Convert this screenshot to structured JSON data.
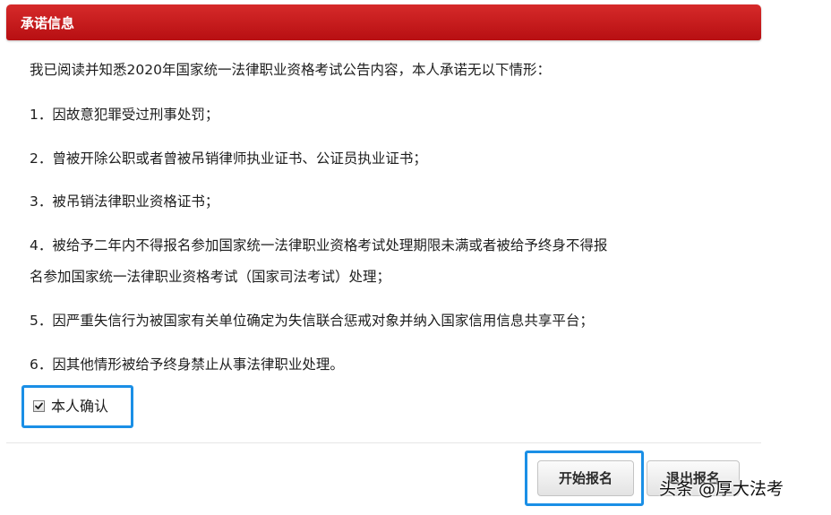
{
  "header": {
    "title": "承诺信息",
    "color": "#c4161c"
  },
  "content": {
    "intro": "我已阅读并知悉2020年国家统一法律职业资格考试公告内容，本人承诺无以下情形：",
    "items": [
      "1．因故意犯罪受过刑事处罚；",
      "2．曾被开除公职或者曾被吊销律师执业证书、公证员执业证书；",
      "3．被吊销法律职业资格证书；",
      "4．被给予二年内不得报名参加国家统一法律职业资格考试处理期限未满或者被给予终身不得报",
      "名参加国家统一法律职业资格考试（国家司法考试）处理；",
      "5．因严重失信行为被国家有关单位确定为失信联合惩戒对象并纳入国家信用信息共享平台；",
      "6．因其他情形被给予终身禁止从事法律职业处理。"
    ]
  },
  "confirm": {
    "label": "本人确认",
    "checked": true
  },
  "buttons": {
    "start": "开始报名",
    "exit": "退出报名"
  },
  "highlight_color": "#1a8fe6",
  "watermark": "头条 @厚大法考"
}
